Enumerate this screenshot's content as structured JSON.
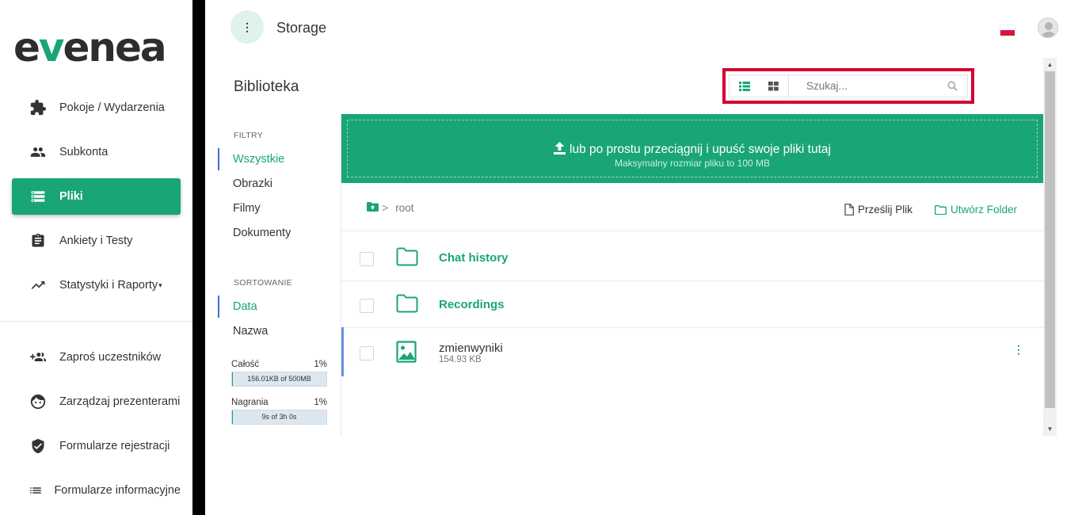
{
  "brand": {
    "logo_pre": "e",
    "logo_v": "v",
    "logo_post": "enea",
    "accent": "#19a578"
  },
  "sidebar": {
    "items": [
      {
        "label": "Pokoje / Wydarzenia",
        "icon": "puzzle-icon"
      },
      {
        "label": "Subkonta",
        "icon": "people-icon"
      },
      {
        "label": "Pliki",
        "icon": "storage-icon",
        "active": true
      },
      {
        "label": "Ankiety i Testy",
        "icon": "clipboard-icon"
      },
      {
        "label": "Statystyki i Raporty",
        "icon": "trending-up-icon",
        "caret": "▾"
      },
      {
        "label": "Zaproś uczestników",
        "icon": "group-add-icon"
      },
      {
        "label": "Zarządzaj prezenterami",
        "icon": "face-icon"
      },
      {
        "label": "Formularze rejestracji",
        "icon": "shield-check-icon"
      },
      {
        "label": "Formularze informacyjne",
        "icon": "list-icon"
      }
    ]
  },
  "topbar": {
    "menu_glyph": "⋮",
    "title": "Storage",
    "flag": "pl-flag",
    "avatar": "user-avatar"
  },
  "main": {
    "title": "Biblioteka",
    "search_placeholder": "Szukaj...",
    "view_modes": [
      "list-view-icon",
      "grid-view-icon"
    ]
  },
  "filters": {
    "filters_heading": "FILTRY",
    "filter_items": [
      "Wszystkie",
      "Obrazki",
      "Filmy",
      "Dokumenty"
    ],
    "active_filter": "Wszystkie",
    "sort_heading": "SORTOWANIE",
    "sort_items": [
      "Data",
      "Nazwa"
    ],
    "active_sort": "Data",
    "usage_total": {
      "label": "Całość",
      "percent": "1%",
      "detail": "156.01KB of 500MB",
      "fraction": 0.01
    },
    "usage_recordings": {
      "label": "Nagrania",
      "percent": "1%",
      "detail": "9s of 3h 0s",
      "fraction": 0.01
    }
  },
  "dropzone": {
    "main_text": "lub po prostu przeciągnij i upuść swoje pliki tutaj",
    "sub_text": "Maksymalny rozmiar pliku to 100 MB"
  },
  "breadcrumb": {
    "separator": ">",
    "current": "root"
  },
  "actions": {
    "upload": "Prześlij Plik",
    "create_folder": "Utwórz Folder"
  },
  "files": [
    {
      "name": "Chat history",
      "type": "folder"
    },
    {
      "name": "Recordings",
      "type": "folder"
    },
    {
      "name": "zmienwyniki",
      "type": "image",
      "size": "154.93 KB"
    }
  ],
  "scrollbar": {
    "up": "▲",
    "down": "▼"
  }
}
